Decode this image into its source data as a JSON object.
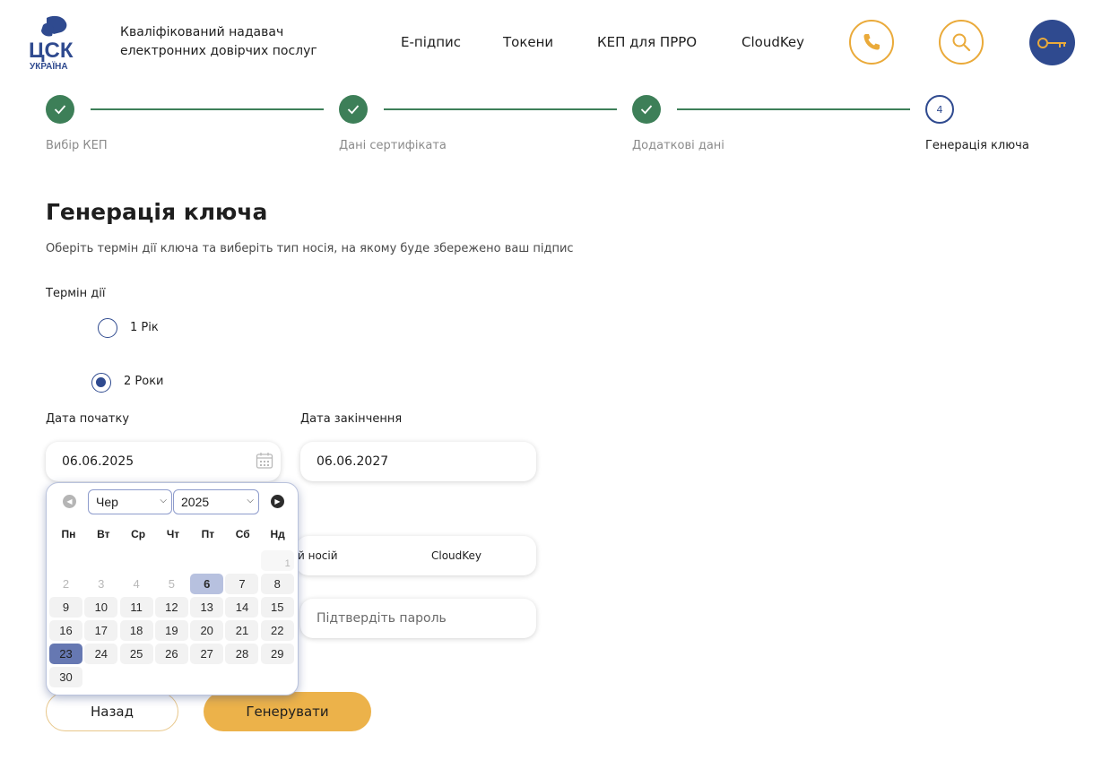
{
  "header": {
    "logo_text": "ЦСК УКРАЇНА",
    "provider_line1": "Кваліфікований надавач",
    "provider_line2": "електронних довірчих послуг",
    "nav": [
      "Е-підпис",
      "Токени",
      "КЕП для ПРРО",
      "CloudKey"
    ],
    "icons": [
      "phone-icon",
      "search-icon",
      "key-icon"
    ],
    "colors": {
      "accent": "#eaaa3a",
      "brand": "#2f4a8f",
      "success": "#3d7f58"
    }
  },
  "stepper": {
    "steps": [
      {
        "label": "Вибір КЕП",
        "state": "done"
      },
      {
        "label": "Дані сертифіката",
        "state": "done"
      },
      {
        "label": "Додаткові дані",
        "state": "done"
      },
      {
        "label": "Генерація ключа",
        "state": "current",
        "number": "4"
      }
    ]
  },
  "main": {
    "title": "Генерація ключа",
    "subtitle": "Оберіть термін дії ключа та виберіть тип носія, на якому буде збережено ваш підпис",
    "term_label": "Термін дії",
    "options": [
      {
        "label": "1 Рік",
        "checked": false
      },
      {
        "label": "2 Роки",
        "checked": true
      }
    ],
    "start_label": "Дата початку",
    "end_label": "Дата закінчення",
    "start_value": "06.06.2025",
    "end_value": "06.06.2027",
    "media_partial": "й носій",
    "media_cloud": "CloudKey",
    "confirm_placeholder": "Підтвердіть пароль",
    "back_label": "Назад",
    "generate_label": "Генерувати"
  },
  "datepicker": {
    "month": "Чер",
    "year": "2025",
    "weekdays": [
      "Пн",
      "Вт",
      "Ср",
      "Чт",
      "Пт",
      "Сб",
      "Нд"
    ],
    "days": [
      "",
      "",
      "",
      "",
      "",
      "",
      "1",
      "2",
      "3",
      "4",
      "5",
      "6",
      "7",
      "8",
      "9",
      "10",
      "11",
      "12",
      "13",
      "14",
      "15",
      "16",
      "17",
      "18",
      "19",
      "20",
      "21",
      "22",
      "23",
      "24",
      "25",
      "26",
      "27",
      "28",
      "29",
      "30"
    ],
    "disabled": [
      "1",
      "2",
      "3",
      "4",
      "5"
    ],
    "today": "6",
    "selected": "23"
  }
}
